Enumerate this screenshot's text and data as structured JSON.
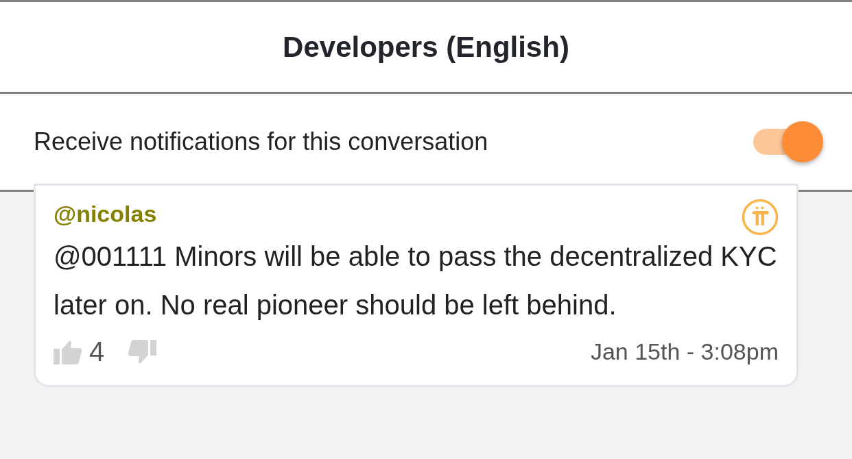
{
  "header": {
    "title": "Developers (English)"
  },
  "notifications": {
    "label": "Receive notifications for this conversation",
    "on": true
  },
  "message": {
    "author": "@nicolas",
    "text": "@001111 Minors will be able to pass the decentralized KYC later on. No real pioneer should be left behind.",
    "likes": "4",
    "time": "Jan 15th - 3:08pm"
  }
}
